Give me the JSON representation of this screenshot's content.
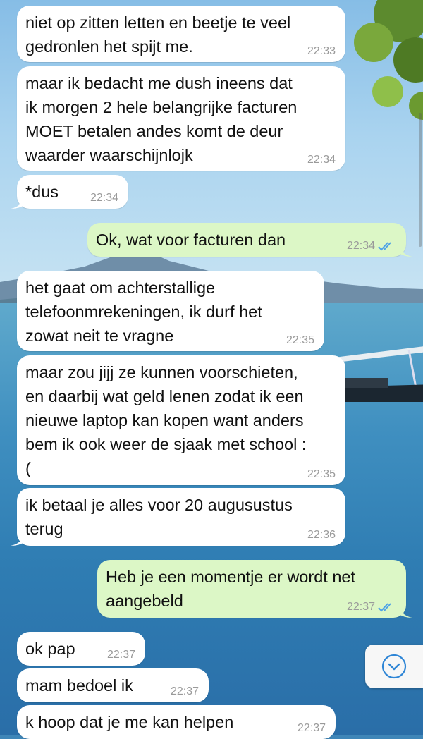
{
  "messages": [
    {
      "dir": "in",
      "text": "niet op zitten letten en beetje te veel\ngedronlen het spijt me.",
      "time": "22:33"
    },
    {
      "dir": "in",
      "text": "maar ik bedacht me dush ineens dat\nik morgen 2 hele belangrijke facturen\nMOET betalen andes komt de deur\nwaarder waarschijnlojk",
      "time": "22:34"
    },
    {
      "dir": "in",
      "text": "*dus",
      "time": "22:34"
    },
    {
      "dir": "out",
      "text": "Ok, wat voor facturen dan",
      "time": "22:34",
      "status": "read"
    },
    {
      "dir": "in",
      "text": "het gaat om achterstallige\ntelefoonmrekeningen, ik durf het\nzowat neit te vragne",
      "time": "22:35"
    },
    {
      "dir": "in",
      "text": "maar zou jijj ze kunnen voorschieten,\nen daarbij wat geld lenen zodat ik een\nnieuwe laptop kan kopen want anders\nbem ik ook weer de sjaak met school :\n(",
      "time": "22:35"
    },
    {
      "dir": "in",
      "text": "ik betaal je alles voor 20 augusustus\nterug",
      "time": "22:36"
    },
    {
      "dir": "out",
      "text": "Heb je een momentje er wordt net\naangebeld",
      "time": "22:37",
      "status": "read"
    },
    {
      "dir": "in",
      "text": "ok pap",
      "time": "22:37"
    },
    {
      "dir": "in",
      "text": "mam bedoel ik",
      "time": "22:37"
    },
    {
      "dir": "in",
      "text": "k hoop dat je me kan helpen",
      "time": "22:37"
    }
  ],
  "colors": {
    "incoming": "#ffffff",
    "outgoing": "#dcf7c6",
    "read_ticks": "#4fa3e6",
    "timestamp": "#9a9a9a"
  },
  "icons": {
    "read_status": "double-check-icon",
    "scroll_down": "chevron-down-circle-icon"
  }
}
